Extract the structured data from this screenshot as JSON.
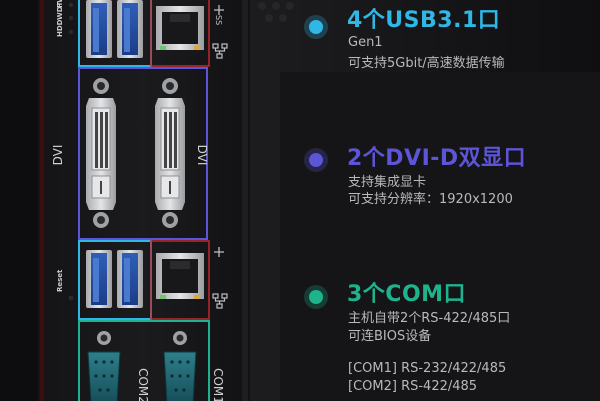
{
  "panel_labels": {
    "hdd": "HDD",
    "wdt": "WDT",
    "pwr": "PWR",
    "reset": "Reset",
    "dvi_left": "DVI",
    "dvi_right": "DVI",
    "com2": "COM2",
    "com1": "COM1"
  },
  "features": [
    {
      "title": "4个USB3.1口",
      "color": "#2fb8e6",
      "lines": [
        "Gen1",
        "可支持5Gbit/高速数据传输"
      ]
    },
    {
      "title": "2个DVI-D双显口",
      "color": "#5d55d8",
      "lines": [
        "支持集成显卡",
        "可支持分辨率：1920x1200"
      ]
    },
    {
      "title": "3个COM口",
      "color": "#1fb38d",
      "lines": [
        "主机自带2个RS-422/485口",
        "可连BIOS设备",
        "[COM1] RS-232/422/485",
        "[COM2] RS-422/485"
      ]
    }
  ],
  "icons": [
    "usb-ss-icon",
    "network-icon"
  ]
}
